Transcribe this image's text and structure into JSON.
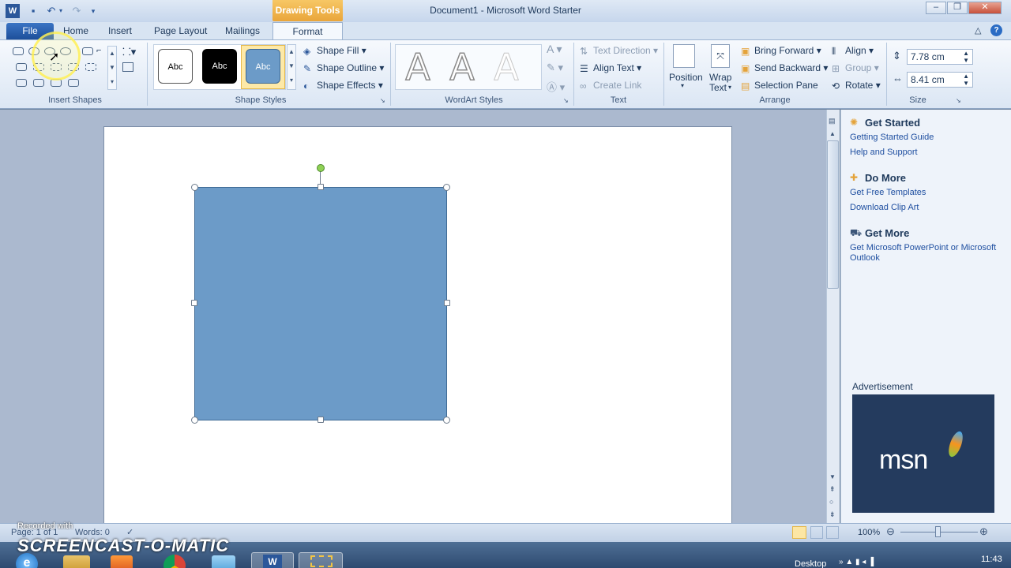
{
  "window": {
    "title": "Document1 - Microsoft Word Starter",
    "contextual_tab": "Drawing Tools"
  },
  "tabs": {
    "file": "File",
    "home": "Home",
    "insert": "Insert",
    "page_layout": "Page Layout",
    "mailings": "Mailings",
    "format": "Format"
  },
  "ribbon": {
    "insert_shapes": {
      "label": "Insert Shapes"
    },
    "shape_styles": {
      "label": "Shape Styles",
      "styles": [
        "Abc",
        "Abc",
        "Abc"
      ],
      "fill": "Shape Fill",
      "outline": "Shape Outline",
      "effects": "Shape Effects"
    },
    "wordart": {
      "label": "WordArt Styles",
      "letters": [
        "A",
        "A",
        "A"
      ]
    },
    "text": {
      "label": "Text",
      "direction": "Text Direction",
      "align": "Align Text",
      "link": "Create Link"
    },
    "arrange": {
      "label": "Arrange",
      "position": "Position",
      "wrap_line1": "Wrap",
      "wrap_line2": "Text",
      "bring_forward": "Bring Forward",
      "send_backward": "Send Backward",
      "selection_pane": "Selection Pane",
      "align": "Align",
      "group": "Group",
      "rotate": "Rotate"
    },
    "size": {
      "label": "Size",
      "height": "7.78 cm",
      "width": "8.41 cm"
    }
  },
  "pane": {
    "get_started": {
      "title": "Get Started",
      "links": [
        "Getting Started Guide",
        "Help and Support"
      ]
    },
    "do_more": {
      "title": "Do More",
      "links": [
        "Get Free Templates",
        "Download Clip Art"
      ]
    },
    "get_more": {
      "title": "Get More",
      "links": [
        "Get Microsoft PowerPoint or Microsoft Outlook"
      ]
    },
    "ad_label": "Advertisement",
    "ad_logo": "msn"
  },
  "status": {
    "page": "Page: 1 of 1",
    "words": "Words: 0",
    "zoom": "100%"
  },
  "taskbar": {
    "clock": "11:43",
    "desktop": "Desktop"
  },
  "watermark": {
    "recorded": "Recorded with",
    "brand": "SCREENCAST-O-MATIC"
  },
  "colors": {
    "shape_fill": "#6c9bc8",
    "accent": "#2b579a",
    "drawing_tools": "#e9a53a"
  }
}
